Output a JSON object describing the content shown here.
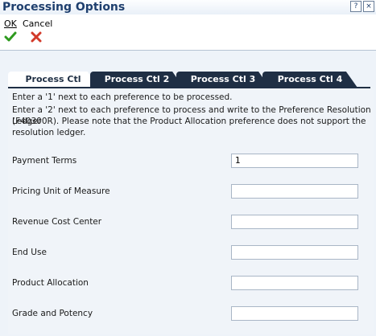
{
  "window": {
    "title": "Processing Options",
    "help_glyph": "?",
    "close_glyph": "×"
  },
  "toolbar": {
    "ok_label": "OK",
    "cancel_label": "Cancel",
    "ok_icon": "check-icon",
    "cancel_icon": "x-icon"
  },
  "tabs": [
    {
      "label": "Process Ctl",
      "active": true
    },
    {
      "label": "Process Ctl 2",
      "active": false
    },
    {
      "label": "Process Ctl 3",
      "active": false
    },
    {
      "label": "Process Ctl 4",
      "active": false
    }
  ],
  "instructions": [
    "Enter a '1' next to each preference to be processed.",
    "Enter a '2' next to each preference to process and write to the Preference Resolution Ledger",
    "(F40300R). Please note that the Product Allocation preference does not support the",
    "resolution ledger."
  ],
  "fields": [
    {
      "label": "Payment Terms",
      "value": "1"
    },
    {
      "label": "Pricing Unit of Measure",
      "value": ""
    },
    {
      "label": "Revenue Cost Center",
      "value": ""
    },
    {
      "label": "End Use",
      "value": ""
    },
    {
      "label": "Product Allocation",
      "value": ""
    },
    {
      "label": "Grade and Potency",
      "value": ""
    }
  ],
  "colors": {
    "title": "#1e3f6e",
    "tab_inactive": "#1f2f44",
    "ok_green": "#2e9a1e",
    "cancel_red": "#d23a2a"
  }
}
